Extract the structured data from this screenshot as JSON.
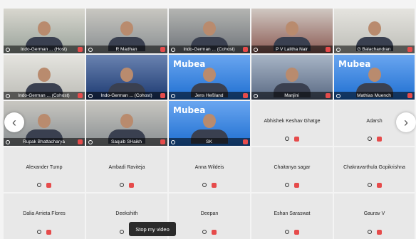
{
  "tiles": [
    {
      "name": "Indo-German ... (Host)",
      "type": "video",
      "scene": "office-window"
    },
    {
      "name": "R Madhan",
      "type": "video",
      "scene": "room",
      "active": true
    },
    {
      "name": "Indo-German ... (Cohost)",
      "type": "video",
      "scene": "office"
    },
    {
      "name": "P V Lalitha Nair",
      "type": "video",
      "scene": "office-red"
    },
    {
      "name": "G Balachandran",
      "type": "video",
      "scene": "office-light"
    },
    {
      "name": "Indo-German ... (Cohost)",
      "type": "video",
      "scene": "office-light"
    },
    {
      "name": "Indo-German ... (Cohost)",
      "type": "video",
      "scene": "city-blue"
    },
    {
      "name": "Jens Heßland",
      "type": "video",
      "scene": "mubea",
      "brand": "Mubea"
    },
    {
      "name": "Manjini",
      "type": "video",
      "scene": "city"
    },
    {
      "name": "Mathias Muench",
      "type": "video",
      "scene": "mubea",
      "brand": "Mubea"
    },
    {
      "name": "Rupak Bhattacharya",
      "type": "video",
      "scene": "room"
    },
    {
      "name": "Saquib SHaikh",
      "type": "video",
      "scene": "room"
    },
    {
      "name": "SK",
      "type": "video",
      "scene": "mubea",
      "brand": "Mubea"
    },
    {
      "name": "Abhishek Keshav Ghatge",
      "type": "blank"
    },
    {
      "name": "Adarsh",
      "type": "blank"
    },
    {
      "name": "Alexander Tump",
      "type": "blank"
    },
    {
      "name": "Ambadi Raviteja",
      "type": "blank"
    },
    {
      "name": "Anna Wildeis",
      "type": "blank"
    },
    {
      "name": "Chaitanya sagar",
      "type": "blank"
    },
    {
      "name": "Chakravarthula Gopikrishna",
      "type": "blank"
    },
    {
      "name": "Dalia Arrieta Flores",
      "type": "blank"
    },
    {
      "name": "Deekshith",
      "type": "blank"
    },
    {
      "name": "Deepan",
      "type": "blank"
    },
    {
      "name": "Eshan Saraswat",
      "type": "blank"
    },
    {
      "name": "Gaurav V",
      "type": "blank"
    }
  ],
  "tooltip": "Stop my video",
  "nav": {
    "left": "‹",
    "right": "›"
  },
  "colors": {
    "accent": "#3fc7b8",
    "muted": "#e64b4b",
    "mubea_blue": "#1f6fd1"
  }
}
